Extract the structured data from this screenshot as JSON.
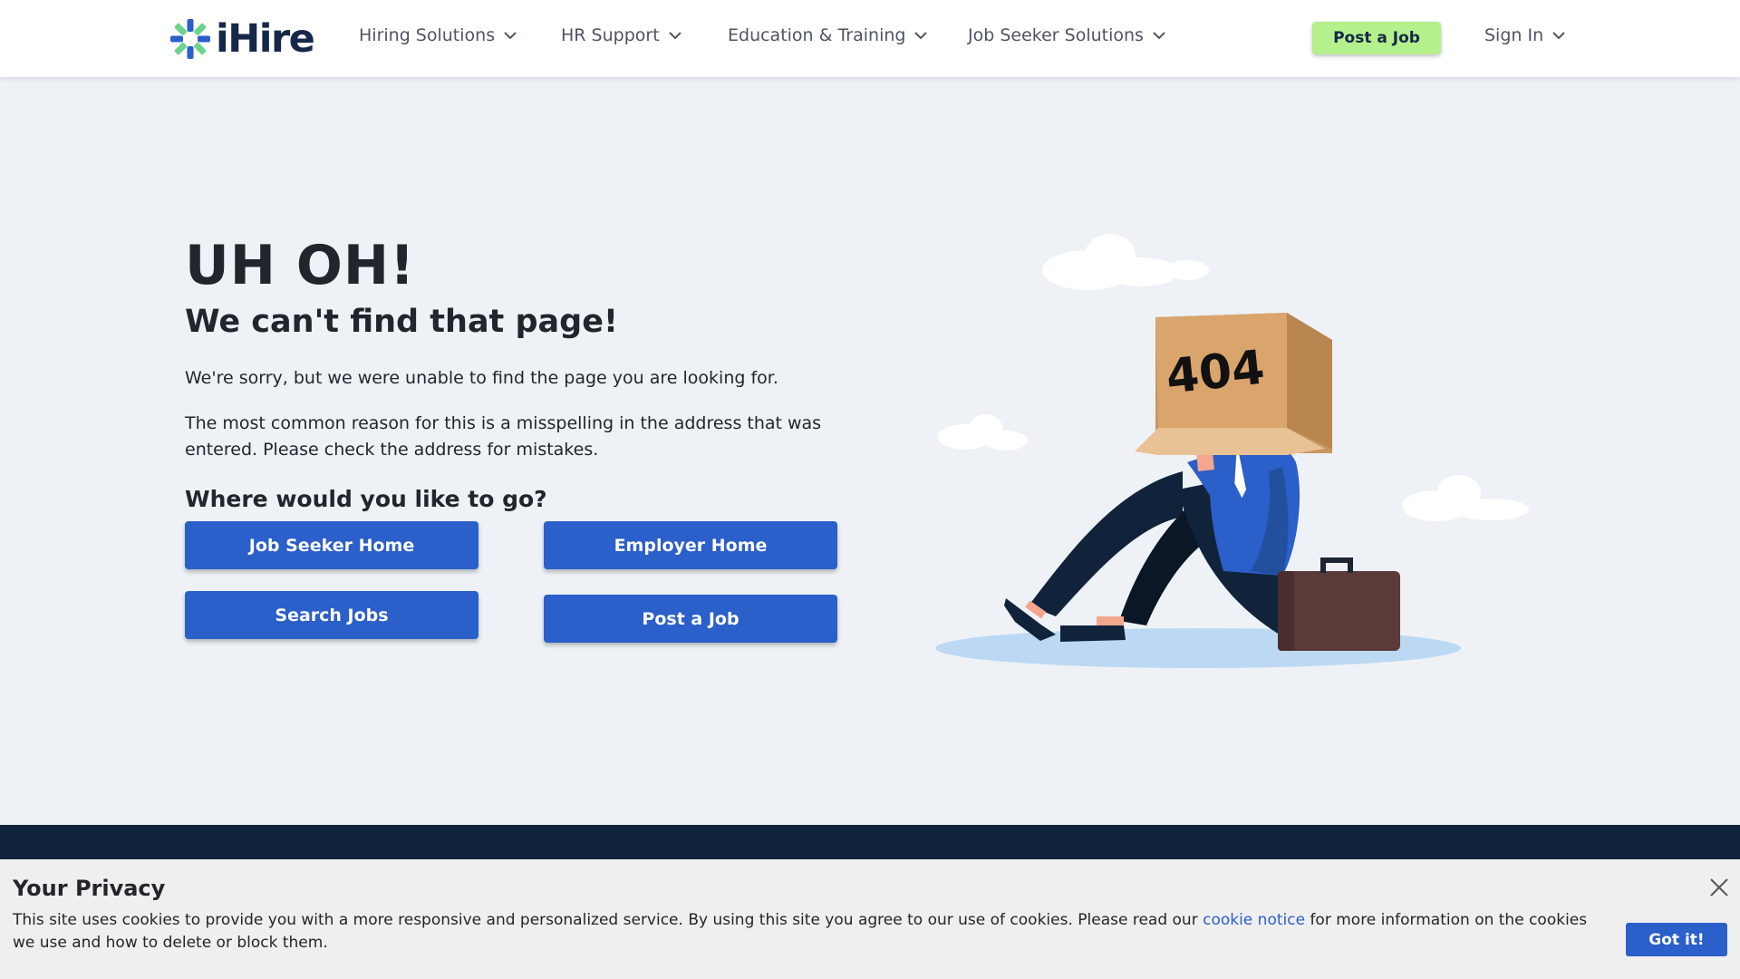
{
  "header": {
    "logo_text": "iHire",
    "nav": [
      {
        "label": "Hiring Solutions"
      },
      {
        "label": "HR Support"
      },
      {
        "label": "Education & Training"
      },
      {
        "label": "Job Seeker Solutions"
      }
    ],
    "post_job_label": "Post a Job",
    "sign_in_label": "Sign In"
  },
  "main": {
    "heading": "UH OH!",
    "subheading": "We can't find that page!",
    "paragraph1": "We're sorry, but we were unable to find the page you are looking for.",
    "paragraph2": "The most common reason for this is a misspelling in the address that was entered. Please check the address for mistakes.",
    "where_heading": "Where would you like to go?",
    "buttons": {
      "job_seeker_home": "Job Seeker Home",
      "employer_home": "Employer Home",
      "search_jobs": "Search Jobs",
      "post_a_job": "Post a Job"
    },
    "illustration_text": "404"
  },
  "cookie": {
    "title": "Your Privacy",
    "text_before": "This site uses cookies to provide you with a more responsive and personalized service. By using this site you agree to our use of cookies. Please read our ",
    "link_text": "cookie notice",
    "text_after": " for more information on the cookies we use and how to delete or block them.",
    "button_label": "Got it!"
  },
  "colors": {
    "brand_navy": "#16284a",
    "accent_green": "#b4f08c",
    "button_blue": "#2b5fc9",
    "page_bg": "#eef2f7",
    "footer_navy": "#10233a"
  },
  "icons": [
    "ihire-logo-icon",
    "chevron-down-icon",
    "close-icon"
  ]
}
